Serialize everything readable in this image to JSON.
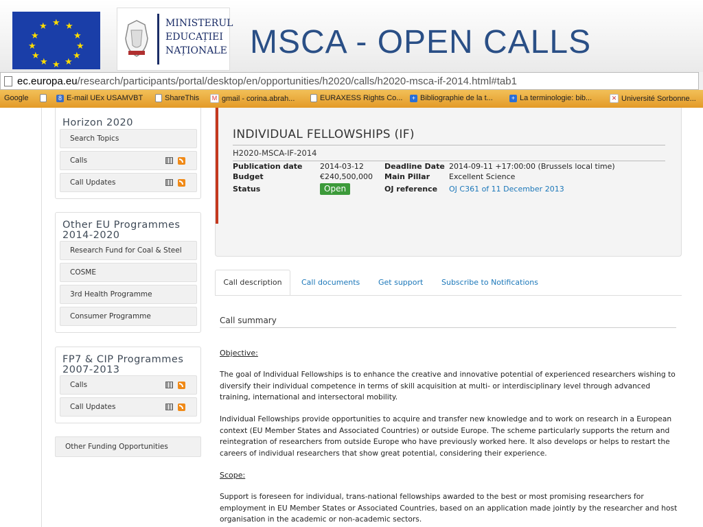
{
  "slide": {
    "title": "MSCA - OPEN CALLS",
    "ministry_lines": [
      "MINISTERUL",
      "EDUCAȚIEI",
      "NAȚIONALE"
    ]
  },
  "browser": {
    "url_host": "ec.europa.eu",
    "url_path": "/research/participants/portal/desktop/en/opportunities/h2020/calls/h2020-msca-if-2014.html#tab1",
    "bookmarks": [
      {
        "label": "Google",
        "icon": "none"
      },
      {
        "label": "",
        "icon": "page-icon"
      },
      {
        "label": "E-mail UEx USAMVBT",
        "icon": "mail-icon"
      },
      {
        "label": "ShareThis",
        "icon": "page-icon"
      },
      {
        "label": "gmail - corina.abrah...",
        "icon": "gmail-icon"
      },
      {
        "label": "EURAXESS Rights Co...",
        "icon": "page-icon"
      },
      {
        "label": "Bibliographie de la t...",
        "icon": "plus-icon"
      },
      {
        "label": "La terminologie: bib...",
        "icon": "plus-icon"
      },
      {
        "label": "Université Sorbonne...",
        "icon": "sorbonne-icon"
      }
    ]
  },
  "sidebar": {
    "horizon": {
      "title": "Horizon 2020",
      "items": [
        "Search Topics",
        "Calls",
        "Call Updates"
      ]
    },
    "other_eu": {
      "title_line1": "Other EU Programmes",
      "title_line2": "2014-2020",
      "items": [
        "Research Fund for Coal & Steel",
        "COSME",
        "3rd Health Programme",
        "Consumer Programme"
      ]
    },
    "fp7": {
      "title_line1": "FP7 & CIP Programmes",
      "title_line2": "2007-2013",
      "items": [
        "Calls",
        "Call Updates"
      ]
    },
    "other_funding": "Other Funding Opportunities"
  },
  "call": {
    "title": "INDIVIDUAL FELLOWSHIPS (IF)",
    "id": "H2020-MSCA-IF-2014",
    "publication_label": "Publication date",
    "publication_value": "2014-03-12",
    "budget_label": "Budget",
    "budget_value": "€240,500,000",
    "status_label": "Status",
    "status_value": "Open",
    "deadline_label": "Deadline Date",
    "deadline_value": "2014-09-11 +17:00:00 (Brussels local time)",
    "pillar_label": "Main Pillar",
    "pillar_value": "Excellent Science",
    "oj_label": "OJ reference",
    "oj_value": "OJ C361 of 11 December 2013"
  },
  "tabs": [
    "Call description",
    "Call documents",
    "Get support",
    "Subscribe to Notifications"
  ],
  "content": {
    "section_title": "Call summary",
    "objective_heading": "Objective:",
    "objective_p1": "The goal of Individual Fellowships is to enhance the creative and innovative potential of experienced researchers wishing to diversify their individual competence in terms of skill acquisition at multi- or interdisciplinary level through advanced training, international and intersectoral mobility.",
    "objective_p2": "Individual Fellowships provide opportunities to acquire and transfer new knowledge and to work on research in a European context (EU Member States and Associated Countries) or outside Europe. The scheme particularly supports the return and reintegration of researchers from outside Europe who have previously worked here. It also develops or helps to restart the careers of individual researchers that show great potential, considering their experience.",
    "scope_heading": "Scope:",
    "scope_p1": "Support is foreseen for individual, trans-national fellowships awarded to the best or most promising researchers for employment in EU Member States or Associated Countries, based on an application made jointly by the researcher and host organisation in the academic or non-academic sectors."
  },
  "colors": {
    "title_blue": "#2a4f86",
    "accent_red": "#c4391f",
    "link_blue": "#1b77b9",
    "status_green": "#3c9a3a",
    "bookmark_orange": "#e39a28"
  }
}
